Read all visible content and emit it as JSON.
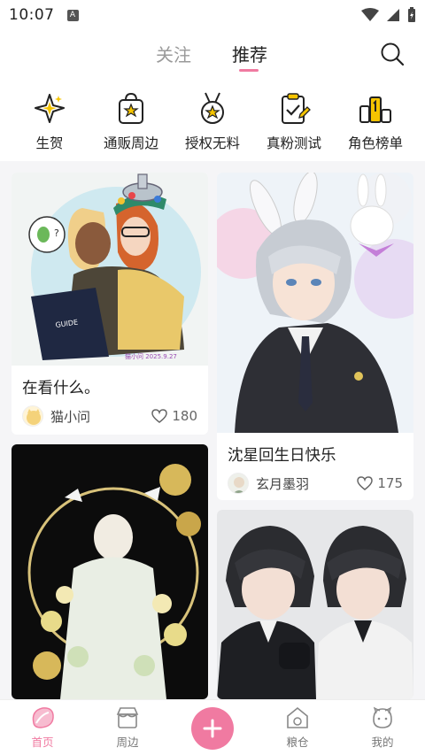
{
  "status_bar": {
    "time": "10:07",
    "notification_badge": "A"
  },
  "top_tabs": {
    "follow": "关注",
    "recommend": "推荐"
  },
  "categories": [
    {
      "label": "生贺",
      "icon": "star-sparkle-icon"
    },
    {
      "label": "通贩周边",
      "icon": "shopping-bag-star-icon"
    },
    {
      "label": "授权无料",
      "icon": "medal-star-icon"
    },
    {
      "label": "真粉测试",
      "icon": "clipboard-check-icon"
    },
    {
      "label": "角色榜单",
      "icon": "podium-icon"
    }
  ],
  "feed": [
    {
      "title": "在看什么。",
      "author": "猫小问",
      "likes": "180",
      "watermark": "猫小问 2025.9.27"
    },
    {
      "title": "沈星回生日快乐",
      "author": "玄月墨羽",
      "likes": "175"
    },
    {
      "title": "",
      "author": "",
      "likes": ""
    },
    {
      "title": "",
      "author": "",
      "likes": ""
    }
  ],
  "bottom_nav": {
    "home": "首页",
    "merch": "周边",
    "granary": "粮仓",
    "mine": "我的"
  },
  "colors": {
    "accent": "#f07aa1",
    "background": "#f5f5f7"
  }
}
